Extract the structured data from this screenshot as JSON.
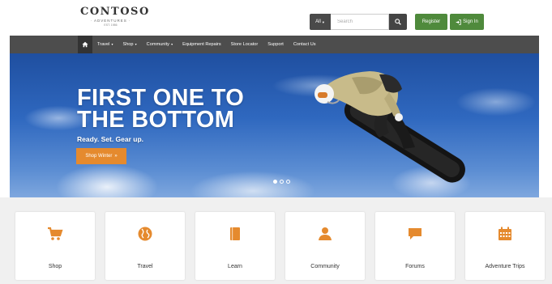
{
  "brand": {
    "name": "CONTOSO",
    "subtitle": "· ADVENTURES ·",
    "established": "EST. 1986"
  },
  "search": {
    "scope_label": "All",
    "placeholder": "Search"
  },
  "account": {
    "register_label": "Register",
    "signin_label": "Sign In"
  },
  "nav": {
    "items": [
      {
        "label": "Travel",
        "dropdown": true
      },
      {
        "label": "Shop",
        "dropdown": true
      },
      {
        "label": "Community",
        "dropdown": true
      },
      {
        "label": "Equipment Repairs",
        "dropdown": false
      },
      {
        "label": "Store Locator",
        "dropdown": false
      },
      {
        "label": "Support",
        "dropdown": false
      },
      {
        "label": "Contact Us",
        "dropdown": false
      }
    ]
  },
  "hero": {
    "title": "FIRST ONE TO\nTHE BOTTOM",
    "tagline": "Ready. Set. Gear up.",
    "cta_label": "Shop Winter",
    "cta_arrow": "»",
    "slide_count": 3,
    "active_slide": 1
  },
  "categories": [
    {
      "label": "Shop",
      "icon": "cart-icon"
    },
    {
      "label": "Travel",
      "icon": "globe-icon"
    },
    {
      "label": "Learn",
      "icon": "book-icon"
    },
    {
      "label": "Community",
      "icon": "person-icon"
    },
    {
      "label": "Forums",
      "icon": "speech-bubble-icon"
    },
    {
      "label": "Adventure Trips",
      "icon": "calendar-icon"
    }
  ],
  "colors": {
    "accent_orange": "#e58a2e",
    "nav_gray": "#4d4d4d",
    "action_green": "#4f8a3c"
  }
}
